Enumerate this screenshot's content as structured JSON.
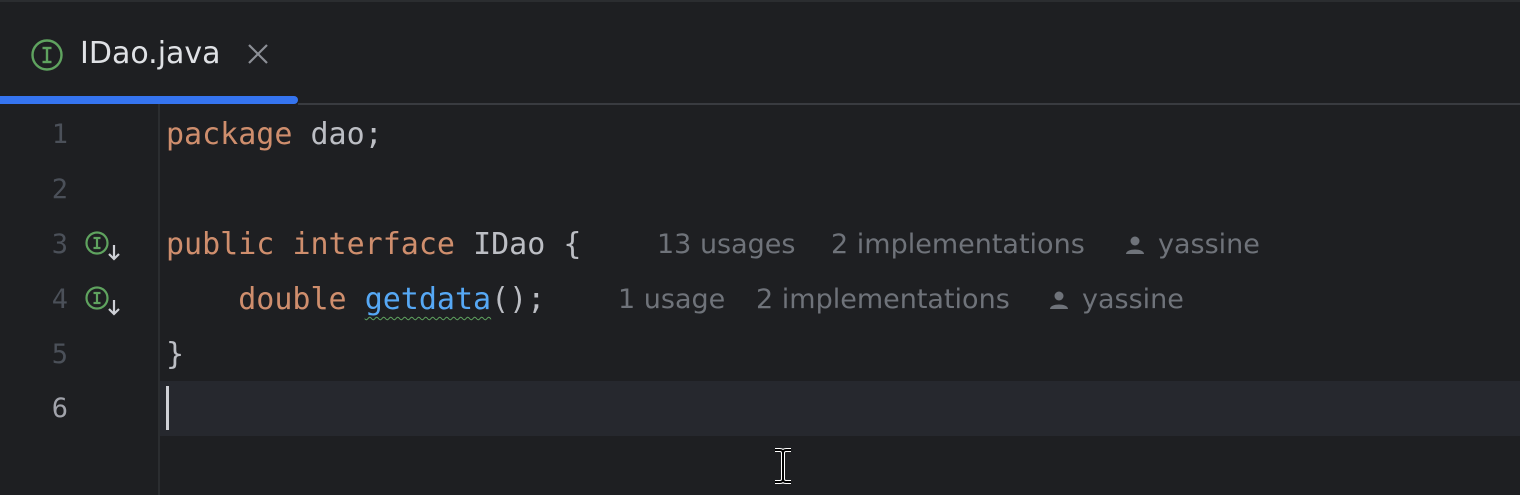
{
  "tab": {
    "filename": "IDao.java",
    "icon": "interface-icon",
    "close_icon": "close-icon"
  },
  "colors": {
    "accent": "#3574f0",
    "keyword": "#cf8e6d",
    "method": "#56a8f5",
    "text": "#bcbec4",
    "hint": "#6f737a",
    "interface_icon": "#5fa35f",
    "background": "#1e1f22"
  },
  "editor": {
    "line_numbers": [
      "1",
      "2",
      "3",
      "4",
      "5",
      "6"
    ],
    "active_line": "6",
    "lines": {
      "l1": {
        "keyword": "package",
        "rest": " dao;"
      },
      "l3": {
        "kw1": "public",
        "kw2": "interface",
        "name": "IDao",
        "brace": "{"
      },
      "l4": {
        "indent": "    ",
        "type": "double",
        "method": "getdata",
        "rest": "();"
      },
      "l5": {
        "brace": "}"
      }
    },
    "hints": {
      "l3": {
        "usages": "13 usages",
        "implementations": "2 implementations",
        "author": "yassine"
      },
      "l4": {
        "usages": "1 usage",
        "implementations": "2 implementations",
        "author": "yassine"
      }
    },
    "gutter_icons": [
      "implemented-interface-icon",
      "implemented-interface-icon"
    ]
  }
}
